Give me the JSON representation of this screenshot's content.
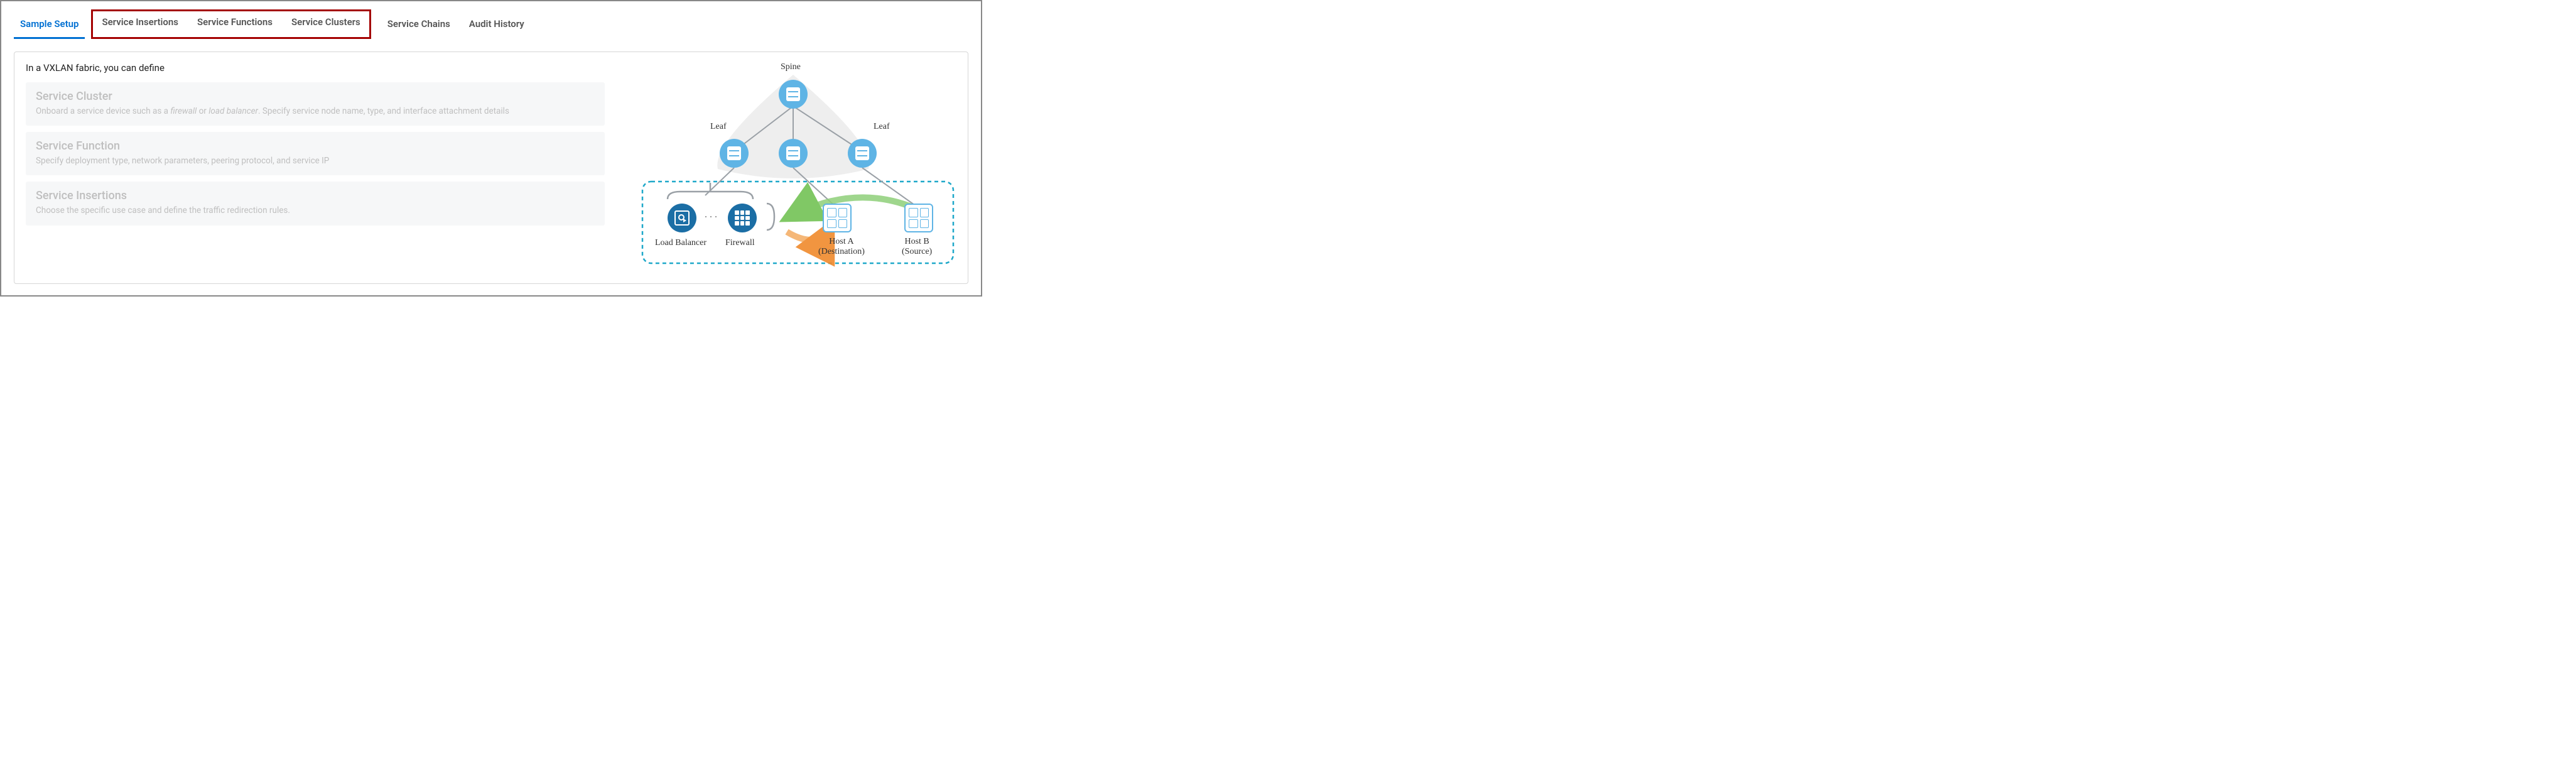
{
  "tabs": {
    "sample_setup": "Sample Setup",
    "service_insertions": "Service Insertions",
    "service_functions": "Service Functions",
    "service_clusters": "Service Clusters",
    "service_chains": "Service Chains",
    "audit_history": "Audit History"
  },
  "intro": "In a VXLAN fabric, you can define",
  "cards": {
    "cluster": {
      "title": "Service Cluster",
      "desc_pre": "Onboard a service device such as a ",
      "em1": "firewall",
      "mid": " or ",
      "em2": "load balancer",
      "desc_post": ". Specify service node name, type, and interface attachment details"
    },
    "function": {
      "title": "Service Function",
      "desc": "Specify deployment type, network parameters, peering protocol, and service IP"
    },
    "insertions": {
      "title": "Service Insertions",
      "desc": "Choose the specific use case and define the traffic redirection rules."
    }
  },
  "diagram": {
    "spine": "Spine",
    "leaf": "Leaf",
    "load_balancer": "Load Balancer",
    "firewall": "Firewall",
    "host_a": "Host A",
    "host_a_sub": "(Destination)",
    "host_b": "Host B",
    "host_b_sub": "(Source)"
  }
}
